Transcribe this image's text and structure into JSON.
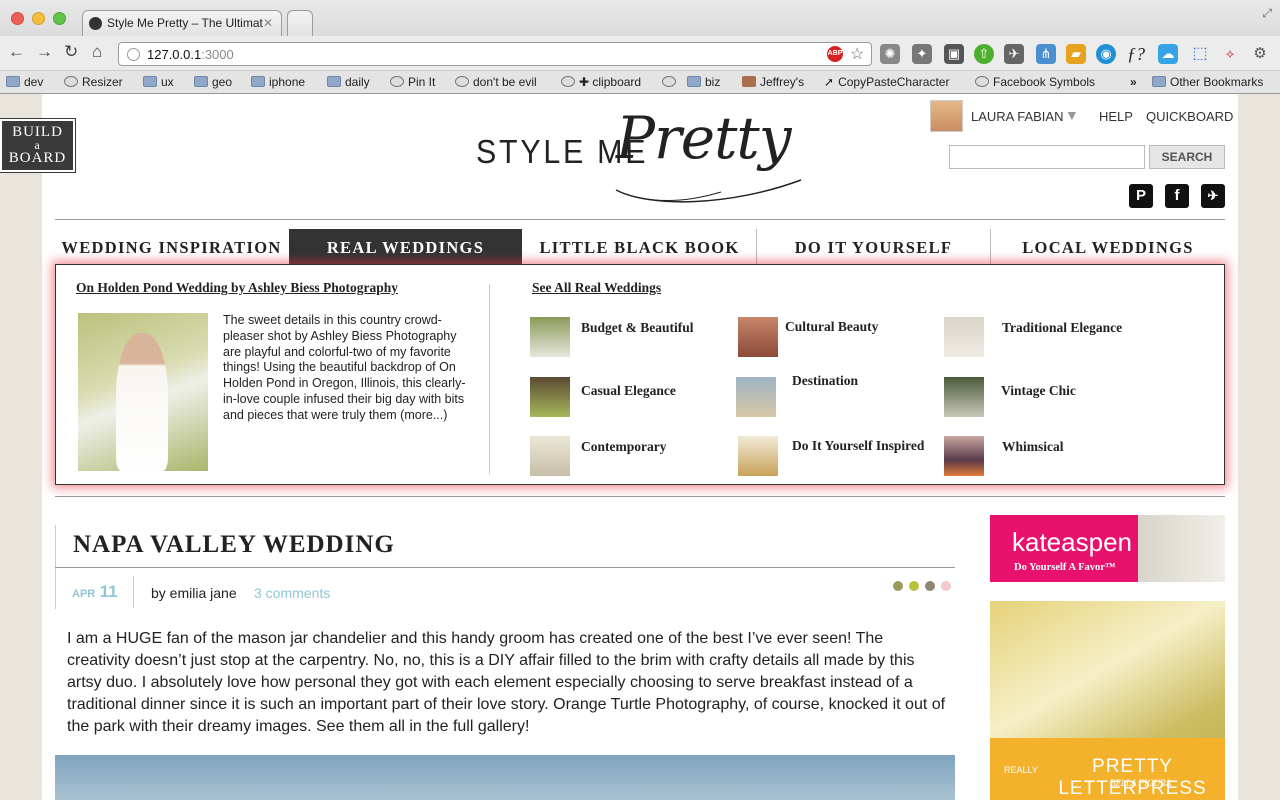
{
  "browser": {
    "tab_title": "Style Me Pretty – The Ultimat",
    "url_host": "127.0.0.1",
    "url_port": ":3000",
    "bookmarks": [
      "dev",
      "Resizer",
      "ux",
      "geo",
      "iphone",
      "daily",
      "Pin It",
      "don't be evil",
      "✚ clipboard",
      "biz",
      "Jeffrey's",
      "CopyPasteCharacter",
      "Facebook Symbols",
      "»",
      "Other Bookmarks"
    ]
  },
  "build_board": {
    "line1": "BUILD",
    "line2": "a",
    "line3": "BOARD"
  },
  "logo": {
    "style_me": "STYLE ME",
    "pretty": "Pretty"
  },
  "user": {
    "name": "LAURA FABIAN",
    "help": "HELP",
    "quickboard": "QUICKBOARD"
  },
  "search": {
    "button": "SEARCH",
    "value": ""
  },
  "social": [
    "pinterest-icon",
    "facebook-icon",
    "twitter-icon"
  ],
  "nav": [
    "WEDDING INSPIRATION",
    "REAL WEDDINGS",
    "LITTLE BLACK BOOK",
    "DO IT YOURSELF",
    "LOCAL WEDDINGS"
  ],
  "nav_active": "REAL WEDDINGS",
  "mega": {
    "feature_title": "On Holden Pond Wedding by Ashley Biess Photography",
    "feature_text": "The sweet details in this country crowd-pleaser shot by Ashley Biess Photography are playful and colorful-two of my favorite things! Using the beautiful backdrop of On Holden Pond in Oregon, Illinois, this clearly-in-love couple infused their big day with bits and pieces that were truly them (more...)",
    "see_all": "See All Real Weddings",
    "categories": [
      "Budget & Beautiful",
      "Cultural Beauty",
      "Traditional Elegance",
      "Casual Elegance",
      "Destination",
      "Vintage Chic",
      "Contemporary",
      "Do It Yourself Inspired",
      "Whimsical"
    ]
  },
  "post": {
    "title": "NAPA VALLEY WEDDING",
    "month": "APR",
    "day": "11",
    "byline": "by emilia jane",
    "comments": "3 comments",
    "body": "I am a HUGE fan of the mason jar chandelier and this handy groom has created one of the best I’ve ever seen! The creativity doesn’t just stop at the carpentry. No, no, this is a DIY affair filled to the brim with crafty details all made by this artsy duo. I absolutely love how personal they got with each element especially choosing to serve breakfast instead of a traditional dinner since it is such an important part of their love story. Orange Turtle Photography, of course, knocked it out of the park with their dreamy images. See them all in the full gallery!",
    "palette": [
      "#9b9a5a",
      "#b9c13a",
      "#8f8770",
      "#f3c9c9"
    ]
  },
  "ads": {
    "kate_brand": "kateaspen",
    "kate_tag": "Do Yourself A Favor™",
    "letterpress_really": "REALLY",
    "letterpress": "PRETTY LETTERPRESS",
    "letterpress_by": "BELLA FIGURA"
  }
}
